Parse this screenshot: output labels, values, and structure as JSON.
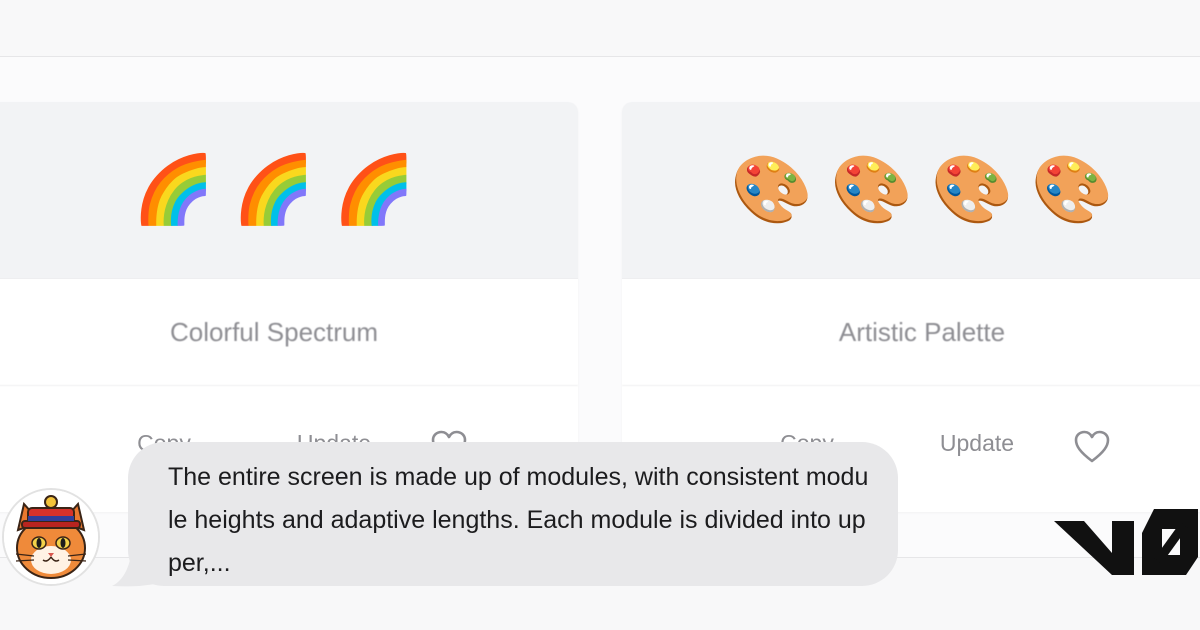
{
  "cards": [
    {
      "emoji": [
        "🌈",
        "🌈",
        "🌈"
      ],
      "title": "Colorful Spectrum",
      "actions": [
        "Copy",
        "Update"
      ],
      "heart_icon": "heart-outline-icon"
    },
    {
      "emoji": [
        "🎨",
        "🎨",
        "🎨",
        "🎨"
      ],
      "title": "Artistic Palette",
      "actions": [
        "Copy",
        "Update"
      ],
      "heart_icon": "heart-outline-icon"
    }
  ],
  "chat": {
    "avatar_icon": "cat-avatar-icon",
    "message": "The entire screen is made up of modules, with consistent module heights and adaptive lengths. Each module is divided into upper,..."
  },
  "brand": {
    "logo_icon": "v0-logo-icon"
  },
  "colors": {
    "background": "#f8f8f9",
    "card": "#ffffff",
    "card_top": "#f2f3f5",
    "muted_text": "#8e8e93",
    "bubble": "#e8e8ea"
  }
}
